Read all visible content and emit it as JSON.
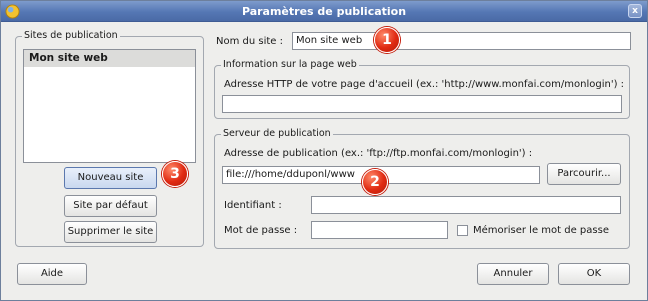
{
  "window": {
    "title": "Paramètres de publication",
    "close_glyph": "x"
  },
  "sites_group": {
    "legend": "Sites de publication",
    "items": [
      "Mon site web"
    ]
  },
  "buttons": {
    "new_site": "Nouveau site",
    "default_site": "Site par défaut",
    "delete_site": "Supprimer le site",
    "browse": "Parcourir...",
    "help": "Aide",
    "cancel": "Annuler",
    "ok": "OK"
  },
  "site_name": {
    "label": "Nom du site :",
    "value": "Mon site web"
  },
  "web_info": {
    "legend": "Information sur la page web",
    "label": "Adresse HTTP de votre page d'accueil (ex.: 'http://www.monfai.com/monlogin') :",
    "value": ""
  },
  "server": {
    "legend": "Serveur de publication",
    "address_label": "Adresse de publication (ex.: 'ftp://ftp.monfai.com/monlogin') :",
    "address_value": "file:///home/dduponl/www",
    "login_label": "Identifiant :",
    "login_value": "",
    "password_label": "Mot de passe :",
    "password_value": "",
    "remember_label": "Mémoriser le mot de passe",
    "remember_checked": false
  },
  "badges": [
    "1",
    "2",
    "3"
  ]
}
